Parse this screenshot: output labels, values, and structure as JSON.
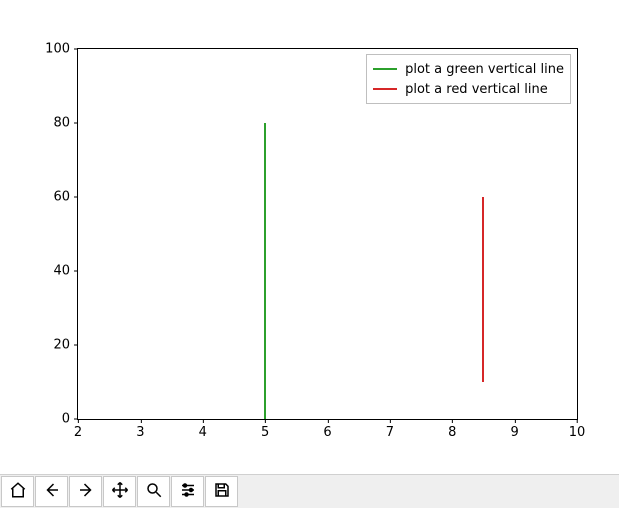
{
  "chart_data": {
    "type": "line",
    "xlim": [
      2,
      10
    ],
    "ylim": [
      0,
      100
    ],
    "x_ticks": [
      2,
      3,
      4,
      5,
      6,
      7,
      8,
      9,
      10
    ],
    "y_ticks": [
      0,
      20,
      40,
      60,
      80,
      100
    ],
    "series": [
      {
        "name": "plot a green vertical line",
        "color": "#2ca02c",
        "x": [
          5,
          5
        ],
        "y": [
          0,
          80
        ]
      },
      {
        "name": "plot a red vertical line",
        "color": "#d62728",
        "x": [
          8.5,
          8.5
        ],
        "y": [
          10,
          60
        ]
      }
    ],
    "legend_position": "upper right"
  },
  "toolbar": {
    "home": "Home",
    "back": "Back",
    "fwd": "Forward",
    "pan": "Pan",
    "zoom": "Zoom",
    "conf": "Configure",
    "save": "Save"
  }
}
